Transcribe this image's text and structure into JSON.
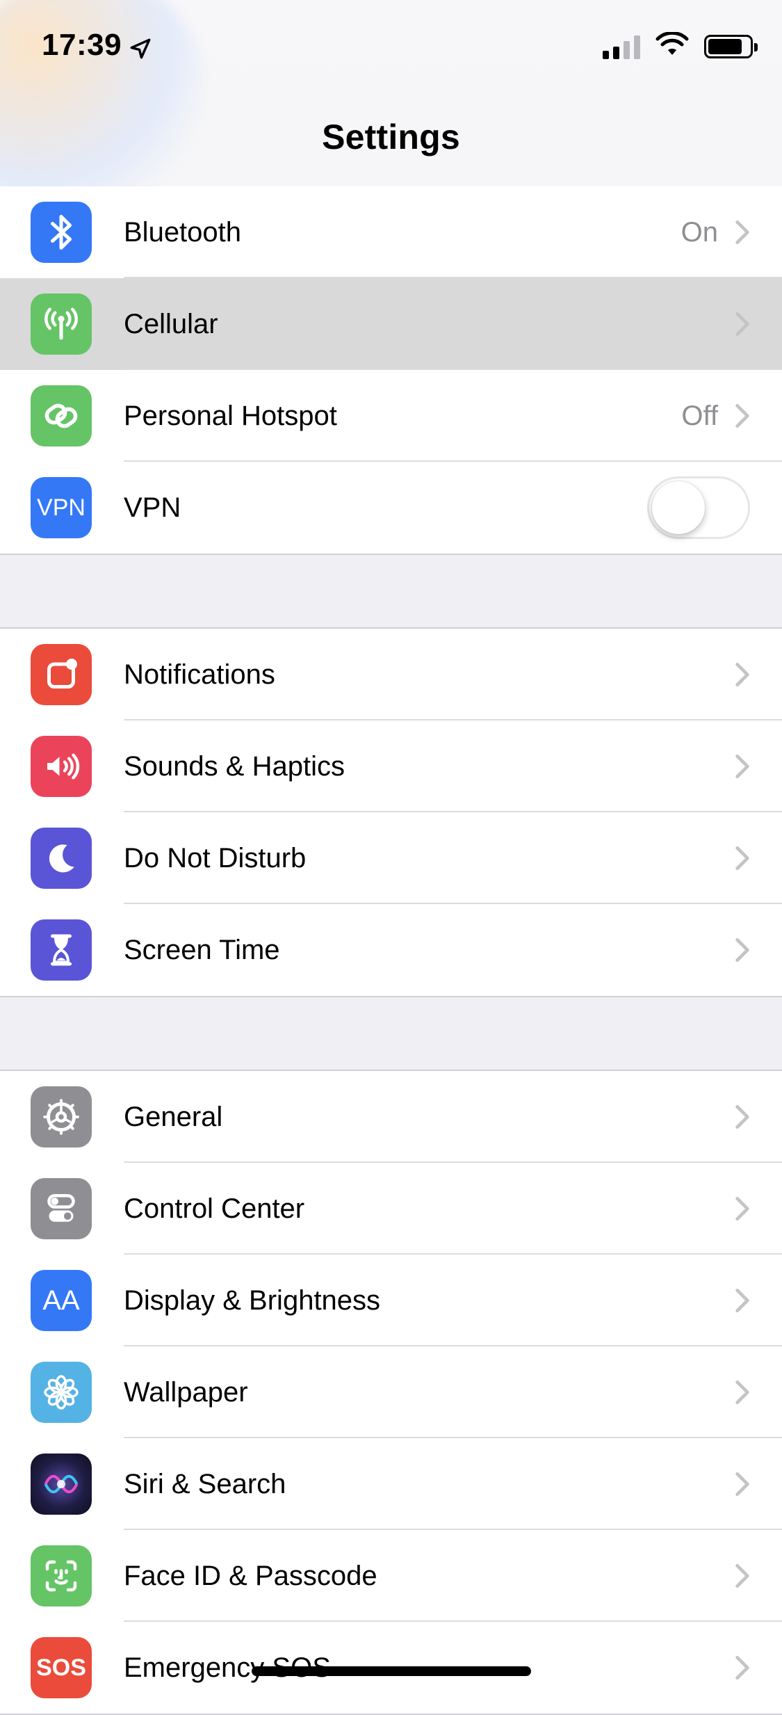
{
  "status_bar": {
    "time": "17:39",
    "location_icon": "location-arrow-icon",
    "signal_icon": "cellular-signal-icon",
    "wifi_icon": "wifi-icon",
    "battery_icon": "battery-icon"
  },
  "nav": {
    "title": "Settings"
  },
  "groups": [
    {
      "rows": [
        {
          "label": "Bluetooth",
          "value": "On",
          "icon": "bluetooth-icon",
          "color": "#3478f6"
        },
        {
          "label": "Cellular",
          "value": "",
          "icon": "cellular-antenna-icon",
          "color": "#65c466",
          "highlighted": true
        },
        {
          "label": "Personal Hotspot",
          "value": "Off",
          "icon": "hotspot-link-icon",
          "color": "#65c466"
        },
        {
          "label": "VPN",
          "icon_text": "VPN",
          "icon": "vpn-icon",
          "color": "#3478f6",
          "toggle": false
        }
      ]
    },
    {
      "rows": [
        {
          "label": "Notifications",
          "icon": "notifications-icon",
          "color": "#ea4b3b"
        },
        {
          "label": "Sounds & Haptics",
          "icon": "speaker-icon",
          "color": "#eb445a"
        },
        {
          "label": "Do Not Disturb",
          "icon": "moon-icon",
          "color": "#5a55d6"
        },
        {
          "label": "Screen Time",
          "icon": "hourglass-icon",
          "color": "#5a55d6"
        }
      ]
    },
    {
      "rows": [
        {
          "label": "General",
          "icon": "gear-icon",
          "color": "#8e8e93"
        },
        {
          "label": "Control Center",
          "icon": "control-center-icon",
          "color": "#8e8e93"
        },
        {
          "label": "Display & Brightness",
          "icon_text": "AA",
          "icon": "display-text-size-icon",
          "color": "#3478f6"
        },
        {
          "label": "Wallpaper",
          "icon": "wallpaper-flower-icon",
          "color": "#55b2e5"
        },
        {
          "label": "Siri & Search",
          "icon": "siri-icon",
          "color": "#1c1c3a"
        },
        {
          "label": "Face ID & Passcode",
          "icon": "face-id-icon",
          "color": "#65c466"
        },
        {
          "label": "Emergency SOS",
          "icon_text": "SOS",
          "icon": "sos-icon",
          "color": "#ea4b3b"
        }
      ]
    }
  ],
  "home_indicator": "home-indicator"
}
